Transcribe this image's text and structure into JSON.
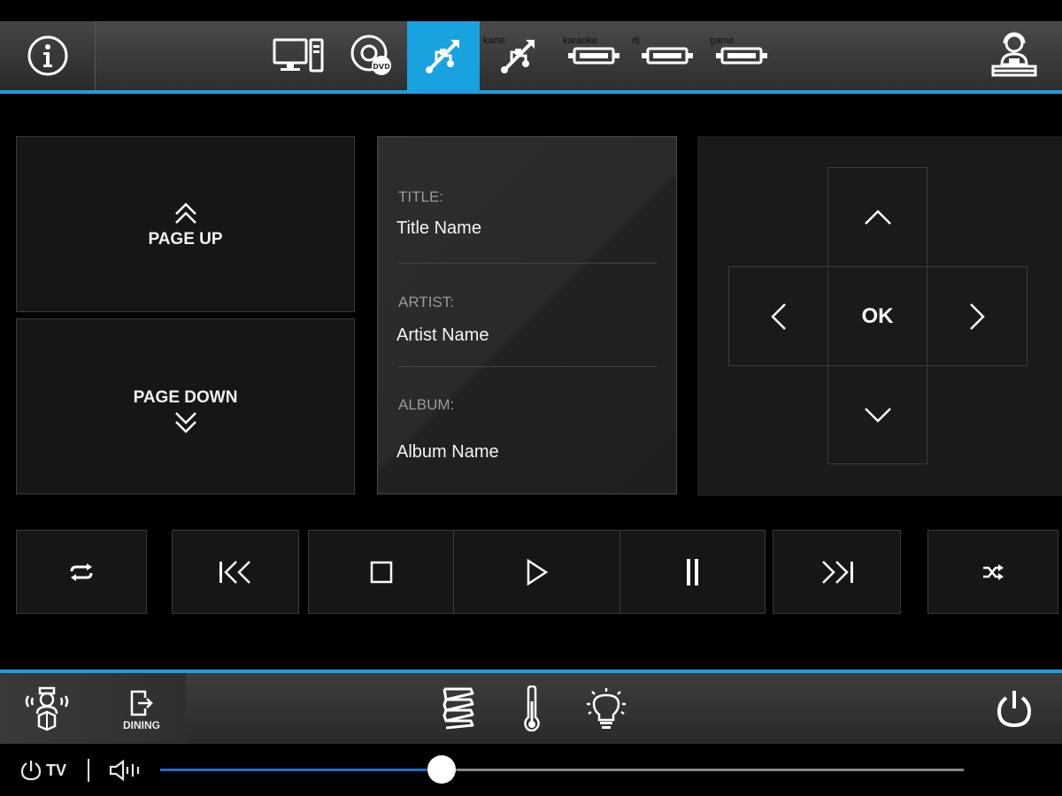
{
  "top_bar": {
    "sources": [
      {
        "name": "pc",
        "label": "",
        "active": false
      },
      {
        "name": "dvd",
        "label": "",
        "active": false
      },
      {
        "name": "usb",
        "label": "",
        "active": true
      },
      {
        "name": "usb-karaoke",
        "label": "karte",
        "active": false
      },
      {
        "name": "hdmi-karaoke",
        "label": "karaoke",
        "active": false
      },
      {
        "name": "hdmi-dj",
        "label": "dj",
        "active": false
      },
      {
        "name": "hdmi-game",
        "label": "game",
        "active": false
      }
    ]
  },
  "navigation": {
    "page_up_label": "PAGE UP",
    "page_down_label": "PAGE DOWN"
  },
  "metadata": {
    "title_label": "TITLE:",
    "title_value": "Title Name",
    "artist_label": "ARTIST:",
    "artist_value": "Artist Name",
    "album_label": "ALBUM:",
    "album_value": "Album Name"
  },
  "dpad": {
    "ok_label": "OK"
  },
  "bottom_bar": {
    "dining_label": "DINING",
    "tv_label": "TV"
  },
  "volume": {
    "level": 0.35
  },
  "colors": {
    "accent": "#1a9fe0",
    "slider_fill": "#1f6fd0"
  }
}
